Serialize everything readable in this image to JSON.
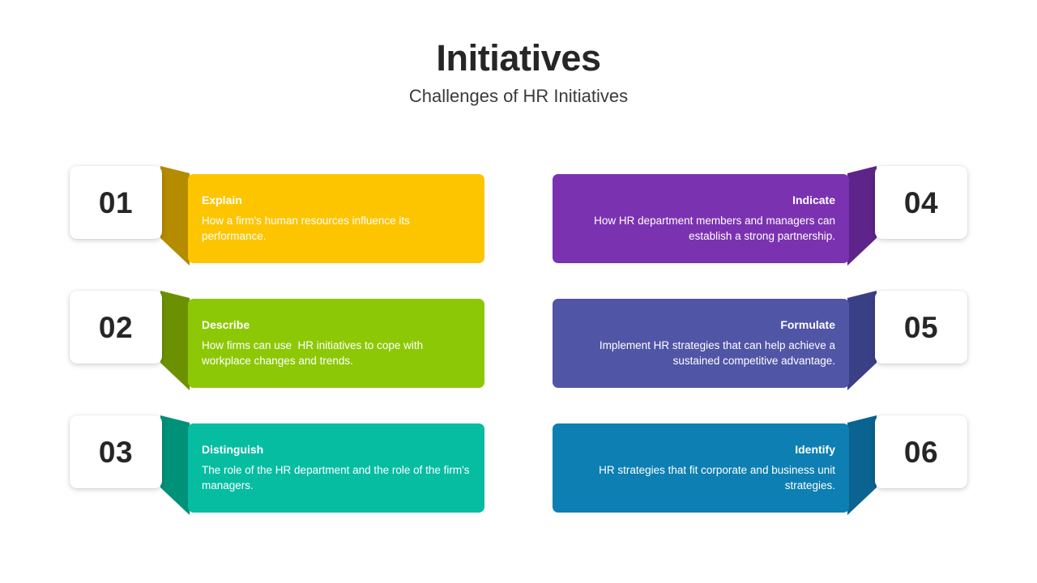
{
  "header": {
    "title": "Initiatives",
    "subtitle": "Challenges of HR Initiatives"
  },
  "colors": {
    "background": "#ffffff",
    "title_text": "#262626",
    "subtitle_text": "#3a3a3a",
    "number_text": "#262626",
    "panel_text": "#ffffff"
  },
  "items": [
    {
      "number": "01",
      "title": "Explain",
      "description": "How a firm's human resources influence its performance.",
      "side": "left",
      "panel_color": "#FDC500",
      "fold_color": "#B58B00"
    },
    {
      "number": "02",
      "title": "Describe",
      "description": "How firms can use  HR initiatives to cope with workplace changes and trends.",
      "side": "left",
      "panel_color": "#8DC807",
      "fold_color": "#6C9100"
    },
    {
      "number": "03",
      "title": "Distinguish",
      "description": "The role of the HR department and the role of the firm's managers.",
      "side": "left",
      "panel_color": "#06BDA2",
      "fold_color": "#009179"
    },
    {
      "number": "04",
      "title": "Indicate",
      "description": "How HR department members and managers can establish a strong partnership.",
      "side": "right",
      "panel_color": "#7B32B0",
      "fold_color": "#5F2489"
    },
    {
      "number": "05",
      "title": "Formulate",
      "description": "Implement HR strategies that can help achieve a sustained competitive advantage.",
      "side": "right",
      "panel_color": "#5055A6",
      "fold_color": "#3A4086"
    },
    {
      "number": "06",
      "title": "Identify",
      "description": "HR strategies that fit corporate and business unit strategies.",
      "side": "right",
      "panel_color": "#0D7FB2",
      "fold_color": "#0A6390"
    }
  ]
}
